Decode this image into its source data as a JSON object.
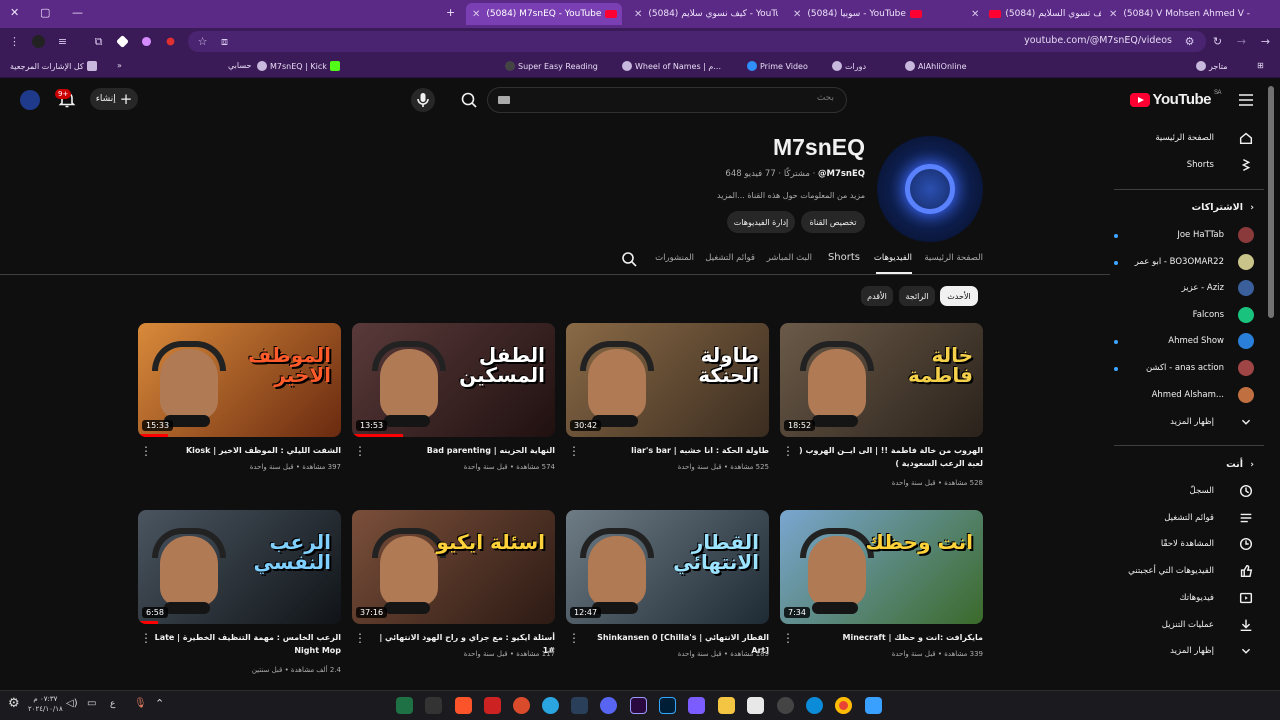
{
  "browser": {
    "tabs": [
      {
        "title": "(5084) V Mohsen Ahmed V - Yo"
      },
      {
        "title": "(5084) كيف تسوي السلايم - YouTube"
      },
      {
        "title": "(5084) سوبيا - YouTube"
      },
      {
        "title": "(5084) كيف نسوي سلايم - YouTube"
      },
      {
        "title": "(5084) M7snEQ - YouTube"
      }
    ],
    "url": "youtube.com/@M7snEQ/videos",
    "bookmarks": [
      "متاجر",
      "AlAhliOnline",
      "دورات",
      "Prime Video",
      "Wheel of Names | م...",
      "Super Easy Reading",
      "M7snEQ | Kick",
      "حسابي",
      "كل الإشارات المرجعية"
    ]
  },
  "header": {
    "logo_text": "YouTube",
    "logo_region": "SA",
    "search_placeholder": "بحث",
    "create_label": "إنشاء",
    "notif_count": "9+"
  },
  "channel": {
    "name": "M7snEQ",
    "handle": "@M7snEQ",
    "stats": "648 مشتركًا · 77 فيديو",
    "description": "مزيد من المعلومات حول هذه القناة ...المزيد",
    "customize_label": "تخصيص القناة",
    "manage_label": "إدارة الفيديوهات"
  },
  "tabs": [
    {
      "label": "الصفحة الرئيسية",
      "active": false
    },
    {
      "label": "الفيديوهات",
      "active": true
    },
    {
      "label": "Shorts",
      "active": false
    },
    {
      "label": "البث المباشر",
      "active": false
    },
    {
      "label": "قوائم التشغيل",
      "active": false
    },
    {
      "label": "المنشورات",
      "active": false
    }
  ],
  "chips": [
    "الأحدث",
    "الرائجة",
    "الأقدم"
  ],
  "videos": [
    {
      "title": "الهروب من خالة فاطمة !! | الى ايــن الهروب ( لعبة الرعب السعودية )",
      "meta": "528 مشاهدة • قبل سنة واحدة",
      "duration": "18:52",
      "thumb_text": "خالة فاطمة",
      "progress": 0.0
    },
    {
      "title": "طاولة الحكة : انا خشبه | liar's bar",
      "meta": "525 مشاهدة • قبل سنة واحدة",
      "duration": "30:42",
      "thumb_text": "طاولة الحنكة",
      "progress": 0.0
    },
    {
      "title": "النهاية الحزينه | Bad parenting",
      "meta": "574 مشاهدة • قبل سنة واحدة",
      "duration": "13:53",
      "thumb_text": "الطفل المسكين",
      "progress": 0.25
    },
    {
      "title": "الشفت الليلي : الموظف الاخير | Kiosk",
      "meta": "397 مشاهدة • قبل سنة واحدة",
      "duration": "15:33",
      "thumb_text": "الموظف الاخير",
      "progress": 0.15
    },
    {
      "title": "مايكرافت :انت و حظك | Minecraft",
      "meta": "339 مشاهدة • قبل سنة واحدة",
      "duration": "7:34",
      "thumb_text": "انت وحظك",
      "progress": 0.0
    },
    {
      "title": "القطار الانتهائي | Shinkansen 0 [Chilla's Art]",
      "meta": "185 مشاهدة • قبل سنة واحدة",
      "duration": "12:47",
      "thumb_text": "القطار الانتهائي",
      "progress": 0.0
    },
    {
      "title": "أسئلة ايكيو : مع جراي و راح الهود الانتهائي | #1",
      "meta": "117 مشاهدة • قبل سنة واحدة",
      "duration": "37:16",
      "thumb_text": "اسئلة ايكيو",
      "progress": 0.0
    },
    {
      "title": "الرعب الخامس : مهمة التنظيف الخطيرة | Late Night Mop",
      "meta": "2.4 ألف مشاهدة • قبل سنتين",
      "duration": "6:58",
      "thumb_text": "الرعب النفسي",
      "progress": 0.1
    }
  ],
  "sidebar": {
    "main": [
      {
        "label": "الصفحة الرئيسية",
        "icon": "home-icon"
      },
      {
        "label": "Shorts",
        "icon": "shorts-icon"
      }
    ],
    "subs_heading": "الاشتراكات",
    "subs": [
      {
        "label": "Joe HaTTab",
        "color": "#8a3a3a",
        "dot": true
      },
      {
        "label": "ابو عمر - BO3OMAR22",
        "color": "#c9c48a",
        "dot": true
      },
      {
        "label": "عزيز - Aziz",
        "color": "#3a5f9a",
        "dot": false
      },
      {
        "label": "Falcons",
        "color": "#19c37d",
        "dot": false
      },
      {
        "label": "Ahmed Show",
        "color": "#2a7fd8",
        "dot": true
      },
      {
        "label": "اكشن - anas action",
        "color": "#a04545",
        "dot": true
      },
      {
        "label": "Ahmed Alsham...",
        "color": "#c07040",
        "dot": false
      }
    ],
    "show_more": "إظهار المزيد",
    "you_heading": "أنت",
    "you": [
      {
        "label": "السجلّ",
        "icon": "history-icon"
      },
      {
        "label": "قوائم التشغيل",
        "icon": "playlists-icon"
      },
      {
        "label": "المشاهدة لاحقًا",
        "icon": "watch-later-icon"
      },
      {
        "label": "الفيديوهات التي أعجبتني",
        "icon": "like-icon"
      },
      {
        "label": "فيديوهاتك",
        "icon": "your-videos-icon"
      },
      {
        "label": "عمليات التنزيل",
        "icon": "download-icon"
      },
      {
        "label": "إظهار المزيد",
        "icon": "chevron-down-icon"
      }
    ]
  },
  "taskbar": {
    "clock_time": "٠٧:٣٧ م",
    "clock_date": "٢٠٢٤/١٠/١٨",
    "lang": "ع"
  }
}
